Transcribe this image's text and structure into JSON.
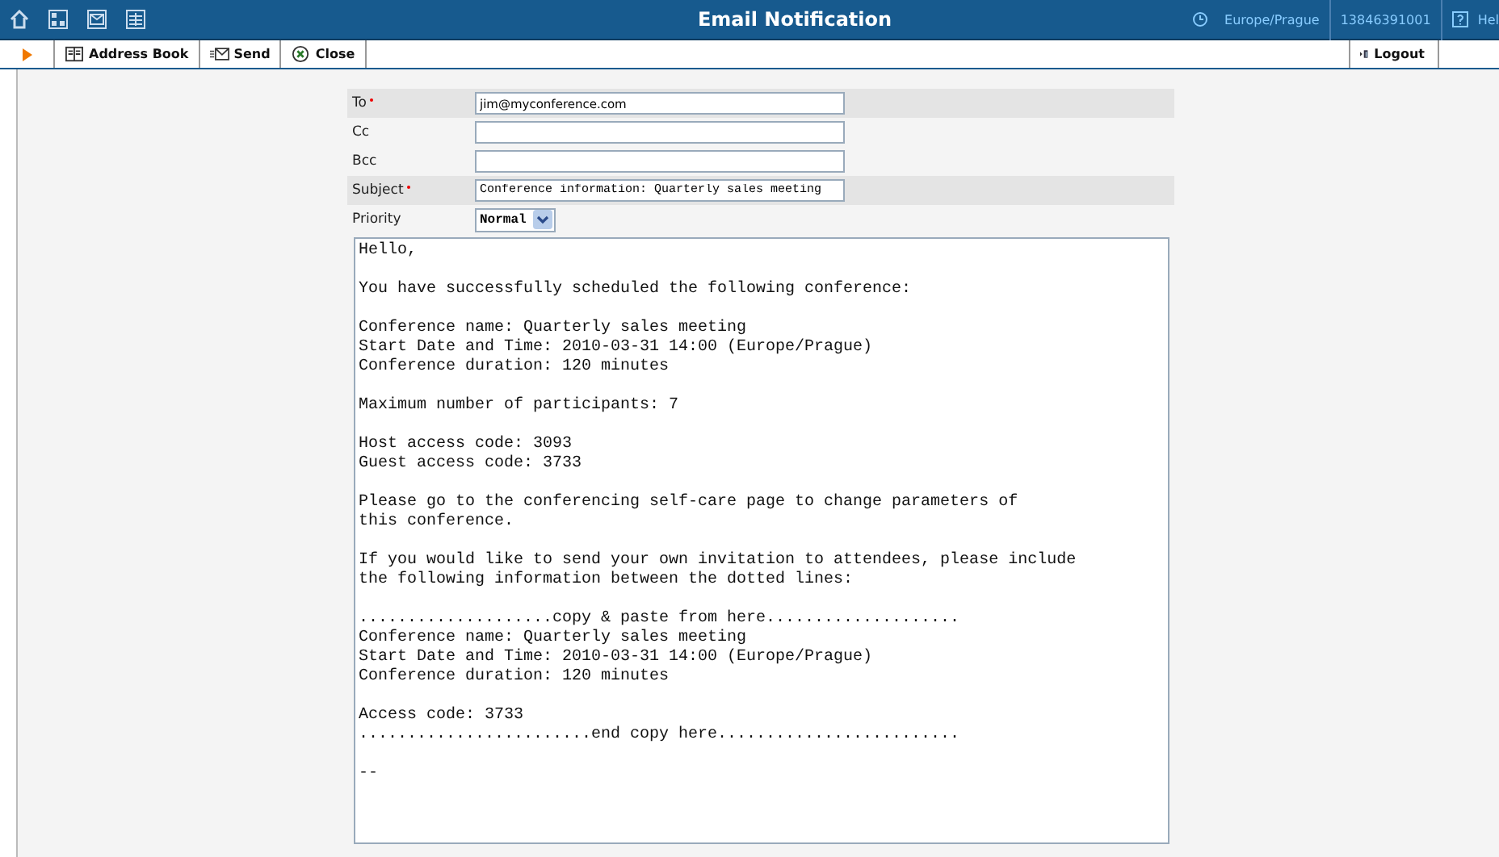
{
  "header": {
    "title": "Email Notification",
    "timezone": "Europe/Prague",
    "account": "13846391001",
    "help": "Hel"
  },
  "toolbar": {
    "buttons": [
      {
        "kind": "address-book",
        "label": "Address Book"
      },
      {
        "kind": "send",
        "label": "Send"
      },
      {
        "kind": "close",
        "label": "Close"
      }
    ],
    "logout": "Logout"
  },
  "form": {
    "fields": [
      {
        "label": "To",
        "required": true,
        "value": "jim@myconference.com"
      },
      {
        "label": "Cc",
        "required": false
      },
      {
        "label": "Bcc",
        "required": false
      },
      {
        "label": "Subject",
        "required": true,
        "value": "Conference information: Quarterly sales meeting"
      }
    ],
    "priority": {
      "label": "Priority",
      "value": "Normal"
    },
    "message": "Hello,\n\nYou have successfully scheduled the following conference:\n\nConference name: Quarterly sales meeting\nStart Date and Time: 2010-03-31 14:00 (Europe/Prague)\nConference duration: 120 minutes\n\nMaximum number of participants: 7\n\nHost access code: 3093\nGuest access code: 3733\n\nPlease go to the conferencing self-care page to change parameters of\nthis conference.\n\nIf you would like to send your own invitation to attendees, please include\nthe following information between the dotted lines:\n\n....................copy & paste from here....................\nConference name: Quarterly sales meeting\nStart Date and Time: 2010-03-31 14:00 (Europe/Prague)\nConference duration: 120 minutes\n\nAccess code: 3733\n........................end copy here.........................\n\n--"
  }
}
